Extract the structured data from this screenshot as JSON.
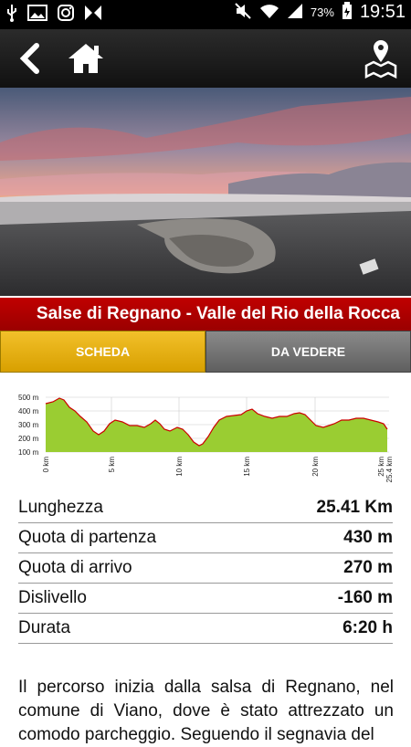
{
  "status": {
    "battery": "73%",
    "time": "19:51"
  },
  "title": "Salse di Regnano - Valle del Rio della Rocca",
  "tabs": [
    {
      "label": "SCHEDA"
    },
    {
      "label": "DA VEDERE"
    }
  ],
  "profile": {
    "y_ticks": [
      "500 m",
      "400 m",
      "300 m",
      "200 m",
      "100 m"
    ],
    "x_ticks": [
      "0 km",
      "5 km",
      "10 km",
      "15 km",
      "20 km",
      "25 km",
      "25.4 km"
    ],
    "line_color": "#cc0000",
    "fill_color": "#9acd32"
  },
  "stats": [
    {
      "label": "Lunghezza",
      "value": "25.41 Km"
    },
    {
      "label": "Quota di partenza",
      "value": "430 m"
    },
    {
      "label": "Quota di arrivo",
      "value": "270 m"
    },
    {
      "label": "Dislivello",
      "value": "-160 m"
    },
    {
      "label": "Durata",
      "value": "6:20 h"
    }
  ],
  "description": "Il percorso inizia dalla salsa di Regnano, nel comune di Viano, dove è stato attrezzato un comodo parcheggio. Seguendo il segnavia del"
}
